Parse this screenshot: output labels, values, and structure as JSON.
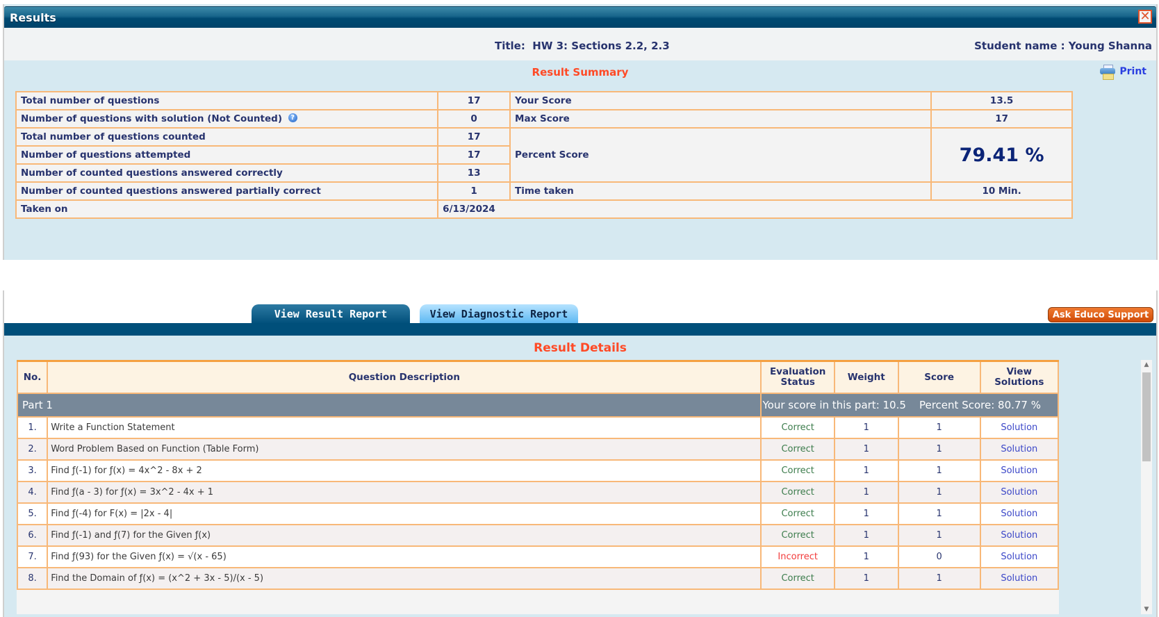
{
  "window": {
    "title": "Results",
    "close_icon": "close-x-icon"
  },
  "info": {
    "title_label": "Title:",
    "title_value": "HW 3: Sections 2.2, 2.3",
    "title_text": "Title:  HW 3: Sections 2.2, 2.3",
    "student_text": "Student name : Young Shanna"
  },
  "summary": {
    "heading": "Result Summary",
    "print_label": "Print",
    "print_icon": "printer-icon",
    "help_icon": "question-circle-icon",
    "rows": [
      {
        "label": "Total number of questions",
        "value": "17"
      },
      {
        "label": "Number of questions with solution (Not Counted)",
        "value": "0"
      },
      {
        "label": "Total number of questions counted",
        "value": "17"
      },
      {
        "label": "Number of questions attempted",
        "value": "17"
      },
      {
        "label": "Number of counted questions answered correctly",
        "value": "13"
      },
      {
        "label": "Number of counted questions answered partially correct",
        "value": "1"
      },
      {
        "label": "Taken on",
        "value": "6/13/2024"
      }
    ],
    "your_score_label": "Your Score",
    "your_score": "13.5",
    "max_score_label": "Max Score",
    "max_score": "17",
    "percent_label": "Percent Score",
    "percent": "79.41 %",
    "time_label": "Time taken",
    "time": "10 Min."
  },
  "tabs": [
    {
      "label": "View Result Report",
      "active": true
    },
    {
      "label": "View Diagnostic Report",
      "active": false
    }
  ],
  "support_button": "Ask Educo Support",
  "details": {
    "heading": "Result Details",
    "columns": {
      "no": "No.",
      "description": "Question Description",
      "status_line1": "Evaluation",
      "status_line2": "Status",
      "weight": "Weight",
      "score": "Score",
      "solutions_line1": "View",
      "solutions_line2": "Solutions"
    },
    "part": {
      "name": "Part 1",
      "summary": "Your score in this part: 10.5    Percent Score: 80.77 %"
    },
    "rows": [
      {
        "no": "1.",
        "desc": "Write a Function Statement",
        "status": "Correct",
        "weight": "1",
        "score": "1",
        "solution": "Solution"
      },
      {
        "no": "2.",
        "desc": "Word Problem Based on Function (Table Form)",
        "status": "Correct",
        "weight": "1",
        "score": "1",
        "solution": "Solution"
      },
      {
        "no": "3.",
        "desc": "Find ƒ(-1) for ƒ(x) = 4x^2 - 8x + 2",
        "status": "Correct",
        "weight": "1",
        "score": "1",
        "solution": "Solution"
      },
      {
        "no": "4.",
        "desc": "Find ƒ(a - 3) for ƒ(x) = 3x^2 - 4x + 1",
        "status": "Correct",
        "weight": "1",
        "score": "1",
        "solution": "Solution"
      },
      {
        "no": "5.",
        "desc": "Find ƒ(-4) for F(x) = |2x - 4|",
        "status": "Correct",
        "weight": "1",
        "score": "1",
        "solution": "Solution"
      },
      {
        "no": "6.",
        "desc": "Find ƒ(-1) and ƒ(7) for the Given ƒ(x)",
        "status": "Correct",
        "weight": "1",
        "score": "1",
        "solution": "Solution"
      },
      {
        "no": "7.",
        "desc": "Find ƒ(93) for the Given ƒ(x) = √(x - 65)",
        "status": "Incorrect",
        "weight": "1",
        "score": "0",
        "solution": "Solution"
      },
      {
        "no": "8.",
        "desc": "Find the Domain of ƒ(x) = (x^2 + 3x - 5)/(x - 5)",
        "status": "Correct",
        "weight": "1",
        "score": "1",
        "solution": "Solution"
      }
    ]
  },
  "colors": {
    "titlebar": "#004a72",
    "accent_heading": "#ff4a26",
    "table_border": "#f8b878",
    "correct": "#3c7c4c",
    "incorrect": "#f23b3b",
    "link": "#3b47c8",
    "part_row": "#778899"
  }
}
